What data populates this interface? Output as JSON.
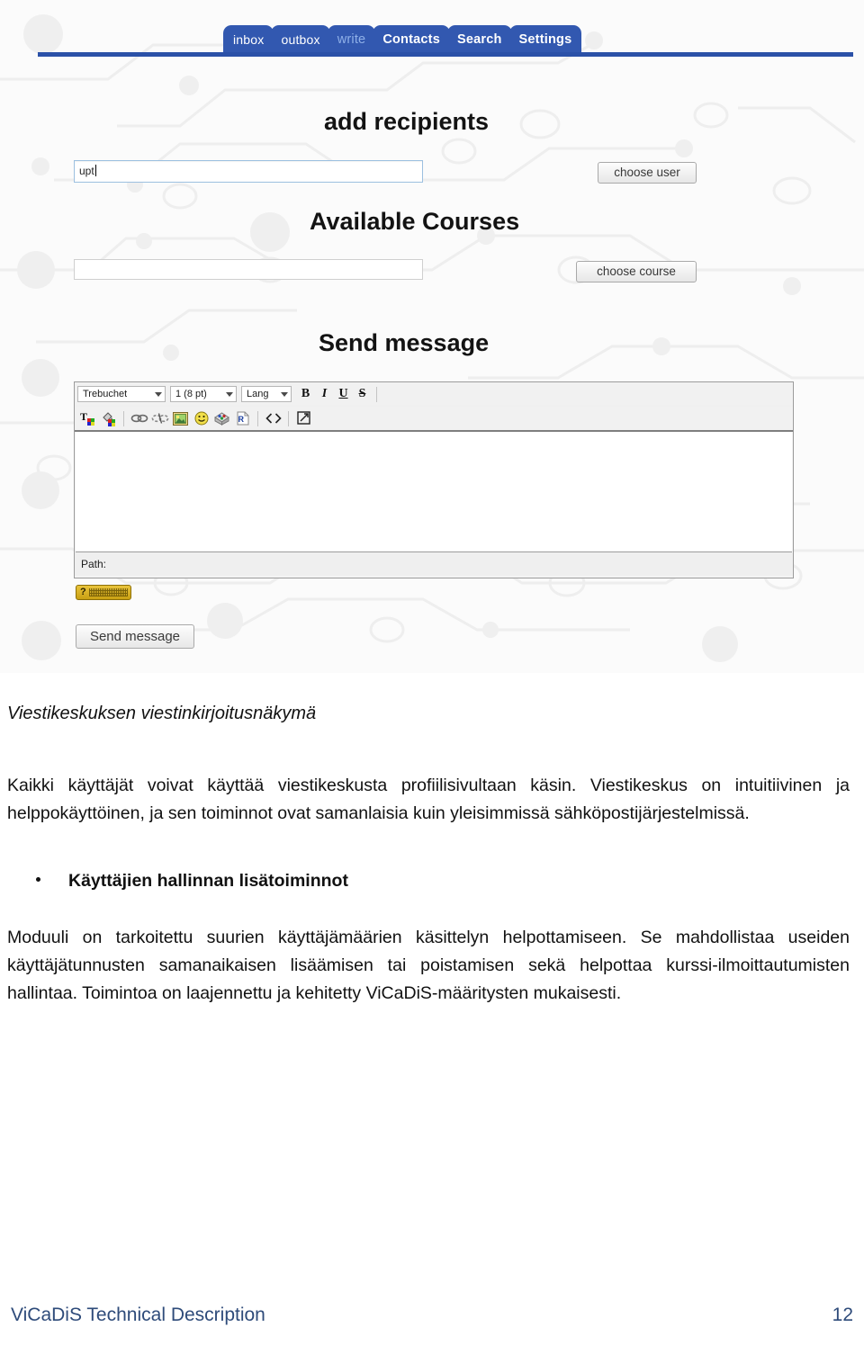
{
  "screenshot": {
    "tabs": [
      {
        "label": "inbox",
        "state": "normal"
      },
      {
        "label": "outbox",
        "state": "normal"
      },
      {
        "label": "write",
        "state": "active"
      },
      {
        "label": "Contacts",
        "state": "normal"
      },
      {
        "label": "Search",
        "state": "normal"
      },
      {
        "label": "Settings",
        "state": "normal"
      }
    ],
    "headings": {
      "add_recipients": "add recipients",
      "available_courses": "Available Courses",
      "send_message": "Send message"
    },
    "recipient_field": {
      "value": "upt",
      "placeholder": ""
    },
    "course_field": {
      "value": "",
      "placeholder": ""
    },
    "buttons": {
      "choose_user": "choose user",
      "choose_course": "choose course",
      "send_message": "Send message"
    },
    "editor": {
      "font_select": "Trebuchet",
      "size_select": "1 (8 pt)",
      "lang_select": "Lang",
      "format_buttons": [
        {
          "label": "B",
          "name": "bold"
        },
        {
          "label": "I",
          "name": "italic"
        },
        {
          "label": "U",
          "name": "underline"
        },
        {
          "label": "S",
          "name": "strikethrough"
        }
      ],
      "tool_icons": [
        "text-color-icon",
        "background-color-icon",
        "insert-link-icon",
        "unlink-icon",
        "insert-image-icon",
        "insert-emoticon-icon",
        "insert-media-icon",
        "insert-document-icon",
        "source-code-icon",
        "fullscreen-icon"
      ],
      "body_text": "",
      "path_label": "Path:",
      "help_badge": "?"
    },
    "colors": {
      "tab_blue": "#3258b0",
      "tab_active_text": "#8fb0e8",
      "underline_blue": "#2b51a8",
      "input_focus_border": "#9cc0e0",
      "help_badge_yellow": "#e9c43c"
    }
  },
  "document": {
    "caption": "Viestikeskuksen viestinkirjoitusnäkymä",
    "paragraph_1": "Kaikki käyttäjät voivat käyttää viestikeskusta profiilisivultaan käsin. Viestikeskus on intuitiivinen ja helppokäyttöinen, ja sen toiminnot ovat samanlaisia kuin yleisimmissä sähköpostijärjestelmissä.",
    "bullet_heading": "Käyttäjien hallinnan lisätoiminnot",
    "paragraph_2": "Moduuli on tarkoitettu suurien käyttäjämäärien käsittelyn helpottamiseen. Se mahdollistaa useiden käyttäjätunnusten samanaikaisen lisäämisen tai poistamisen sekä helpottaa kurssi-ilmoittautumisten hallintaa. Toimintoa on laajennettu ja kehitetty ViCaDiS-määritysten mukaisesti."
  },
  "footer": {
    "title": "ViCaDiS Technical Description",
    "page_number": "12",
    "color": "#2e4b7a"
  }
}
